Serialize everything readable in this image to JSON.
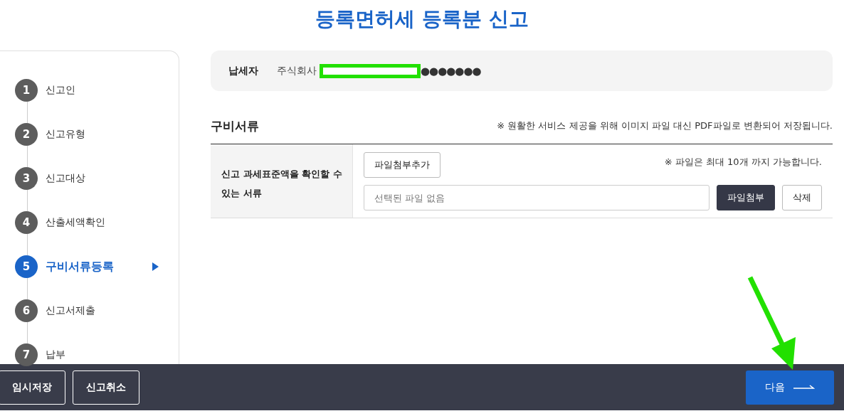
{
  "page_title": "등록면허세 등록분 신고",
  "steps": [
    {
      "number": "1",
      "label": "신고인",
      "selected": false
    },
    {
      "number": "2",
      "label": "신고유형",
      "selected": false
    },
    {
      "number": "3",
      "label": "신고대상",
      "selected": false
    },
    {
      "number": "4",
      "label": "산출세액확인",
      "selected": false
    },
    {
      "number": "5",
      "label": "구비서류등록",
      "selected": true
    },
    {
      "number": "6",
      "label": "신고서제출",
      "selected": false
    },
    {
      "number": "7",
      "label": "납부",
      "selected": false
    }
  ],
  "taxpayer": {
    "label": "납세자",
    "name_prefix": "주식회사",
    "name_masked": "●●●●●●●"
  },
  "documents": {
    "title": "구비서류",
    "notice": "※ 원활한 서비스 제공을 위해 이미지 파일 대신 PDF파일로 변환되어 저장됩니다.",
    "row": {
      "label": "신고 과세표준액을 확인할 수 있는 서류",
      "add_button": "파일첨부추가",
      "limit_note": "※ 파일은 최대 10개 까지 가능합니다.",
      "file_placeholder": "선택된 파일 없음",
      "attach_button": "파일첨부",
      "delete_button": "삭제"
    }
  },
  "footer": {
    "left_buttons": [
      "임시저장",
      "신고취소"
    ],
    "next_button": "다음"
  }
}
